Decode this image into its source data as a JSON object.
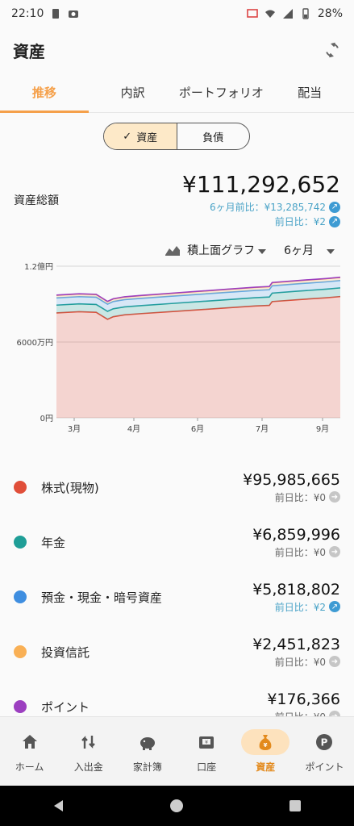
{
  "status_bar": {
    "time": "22:10",
    "battery": "28%"
  },
  "app_bar": {
    "title": "資産"
  },
  "tabs": [
    {
      "label": "推移",
      "active": true
    },
    {
      "label": "内訳",
      "active": false
    },
    {
      "label": "ポートフォリオ",
      "active": false
    },
    {
      "label": "配当",
      "active": false
    }
  ],
  "toggle": {
    "assets_label": "資産",
    "liabilities_label": "負債",
    "selected": "資産"
  },
  "summary": {
    "label": "資産総額",
    "total": "¥111,292,652",
    "six_month": "6ヶ月前比：¥13,285,742",
    "prev_day": "前日比：¥2"
  },
  "chart_controls": {
    "chart_type": "積上面グラフ",
    "period": "6ヶ月"
  },
  "chart_data": {
    "type": "area",
    "stacked": true,
    "x_ticks": [
      "3月",
      "4月",
      "6月",
      "7月",
      "9月"
    ],
    "y_ticks": [
      "1.2億円",
      "6000万円",
      "0円"
    ],
    "ylim": [
      0,
      120000000
    ],
    "grid": true,
    "colors": {
      "stock": "#e04e39",
      "pension": "#1f9e97",
      "cash": "#5aa6e6",
      "fund": "#f9b055",
      "point": "#9c3fc0"
    },
    "x": [
      0,
      8,
      14,
      18,
      20,
      24,
      30,
      40,
      50,
      60,
      70,
      75,
      76,
      85,
      95,
      100
    ],
    "series": [
      {
        "name": "株式(現物)",
        "values": [
          83000000,
          84000000,
          83500000,
          78000000,
          80000000,
          81500000,
          82500000,
          84000000,
          85500000,
          87000000,
          88500000,
          89000000,
          92000000,
          93500000,
          95000000,
          95985665
        ]
      },
      {
        "name": "年金",
        "values": [
          6200000,
          6200000,
          6250000,
          6250000,
          6300000,
          6300000,
          6350000,
          6400000,
          6450000,
          6500000,
          6550000,
          6600000,
          6700000,
          6750000,
          6820000,
          6859996
        ]
      },
      {
        "name": "預金・現金・暗号資産",
        "values": [
          5700000,
          5700000,
          5710000,
          5720000,
          5730000,
          5740000,
          5750000,
          5760000,
          5770000,
          5780000,
          5790000,
          5800000,
          5805000,
          5810000,
          5815000,
          5818802
        ]
      },
      {
        "name": "投資信託",
        "values": [
          2100000,
          2120000,
          2110000,
          2000000,
          2050000,
          2100000,
          2150000,
          2200000,
          2250000,
          2300000,
          2350000,
          2380000,
          2400000,
          2420000,
          2440000,
          2451823
        ]
      },
      {
        "name": "ポイント",
        "values": [
          170000,
          170000,
          170500,
          171000,
          171500,
          172000,
          172500,
          173000,
          173500,
          174000,
          174500,
          175000,
          175500,
          176000,
          176200,
          176366
        ]
      }
    ]
  },
  "legend": [
    {
      "label": "株式(現物)",
      "color": "#e04e39",
      "value": "¥95,985,665",
      "delta": "前日比：¥0",
      "trend": "flat"
    },
    {
      "label": "年金",
      "color": "#1f9e97",
      "value": "¥6,859,996",
      "delta": "前日比：¥0",
      "trend": "flat"
    },
    {
      "label": "預金・現金・暗号資産",
      "color": "#3f8ee0",
      "value": "¥5,818,802",
      "delta": "前日比：¥2",
      "trend": "up"
    },
    {
      "label": "投資信託",
      "color": "#f9b055",
      "value": "¥2,451,823",
      "delta": "前日比：¥0",
      "trend": "flat"
    },
    {
      "label": "ポイント",
      "color": "#9c3fc0",
      "value": "¥176,366",
      "delta": "前日比：¥0",
      "trend": "flat"
    }
  ],
  "bottom_nav": [
    {
      "label": "ホーム",
      "icon": "home-icon",
      "active": false
    },
    {
      "label": "入出金",
      "icon": "transfer-icon",
      "active": false
    },
    {
      "label": "家計簿",
      "icon": "piggy-bank-icon",
      "active": false
    },
    {
      "label": "口座",
      "icon": "wallet-icon",
      "active": false
    },
    {
      "label": "資産",
      "icon": "money-bag-icon",
      "active": true
    },
    {
      "label": "ポイント",
      "icon": "point-icon",
      "active": false
    }
  ]
}
